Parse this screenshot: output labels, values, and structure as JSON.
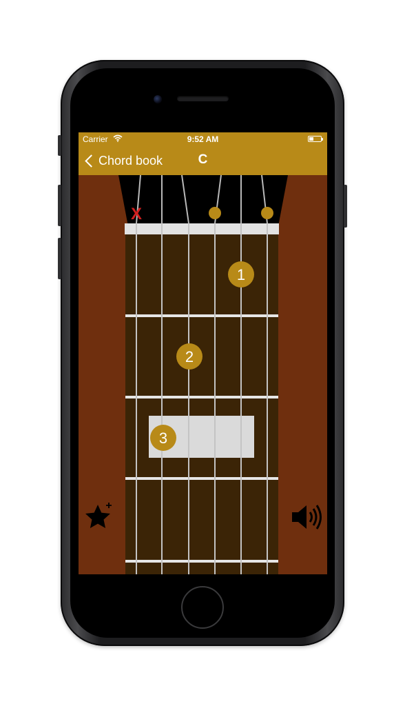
{
  "status_bar": {
    "carrier": "Carrier",
    "time": "9:52 AM"
  },
  "nav_bar": {
    "back_label": "Chord book",
    "title": "C"
  },
  "chord": {
    "muted_marker": "X",
    "open_strings": [
      5,
      6
    ],
    "muted_strings": [
      1
    ],
    "fingers": [
      {
        "label": "1",
        "string": 5,
        "fret": 1
      },
      {
        "label": "2",
        "string": 3,
        "fret": 2
      },
      {
        "label": "3",
        "string": 2,
        "fret": 3
      }
    ]
  },
  "icons": {
    "favorite": "star-plus-icon",
    "sound": "speaker-icon",
    "wifi": "wifi-icon",
    "battery": "battery-icon",
    "back": "chevron-left-icon"
  },
  "colors": {
    "accent": "#b88a18",
    "background": "#6f2f0e",
    "fretboard": "#3b2406",
    "nut": "#e2e2e2",
    "muted": "#d21f1f",
    "finger_dot": "#b88a18"
  }
}
